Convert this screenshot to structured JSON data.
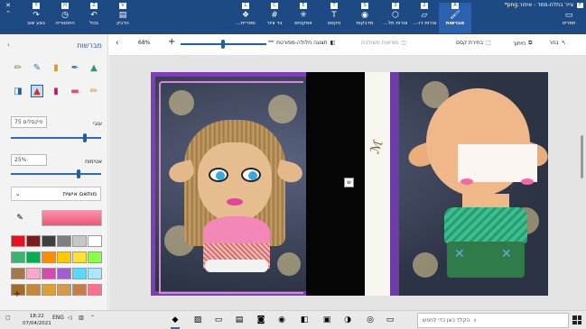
{
  "window": {
    "title": "צייר בתלת-ממד - איפור.png*",
    "shortcut_badge": "F",
    "menu_label": "תפריט"
  },
  "ribbon": {
    "tabs": [
      {
        "key": "A",
        "label": "מברשות",
        "icon": "brush-icon",
        "glyph": "🖌",
        "active": true
      },
      {
        "key": "2",
        "label": "צורות דו-...",
        "icon": "2d-shapes-icon",
        "glyph": "▱",
        "active": false
      },
      {
        "key": "3",
        "label": "צורות תל...",
        "icon": "3d-shapes-icon",
        "glyph": "⬡",
        "active": false
      },
      {
        "key": "S",
        "label": "מדבקות",
        "icon": "stickers-icon",
        "glyph": "◉",
        "active": false
      },
      {
        "key": "T",
        "label": "טקסט",
        "icon": "text-icon",
        "glyph": "T",
        "active": false
      },
      {
        "key": "E",
        "label": "אפקטים",
        "icon": "effects-icon",
        "glyph": "✳",
        "active": false
      },
      {
        "key": "C",
        "label": "בד ציור",
        "icon": "canvas-icon",
        "glyph": "#",
        "active": false
      },
      {
        "key": "L",
        "label": "ספריית...",
        "icon": "library-icon",
        "glyph": "❖",
        "active": false
      }
    ],
    "actions": [
      {
        "key": "V",
        "label": "הדבק",
        "icon": "paste-icon",
        "glyph": "▤"
      },
      {
        "key": "Z",
        "label": "בטל",
        "icon": "undo-icon",
        "glyph": "↶"
      },
      {
        "key": "H",
        "label": "היסטוריה",
        "icon": "history-icon",
        "glyph": "◷"
      },
      {
        "key": "Y",
        "label": "בצע שוב",
        "icon": "redo-icon",
        "glyph": "↷"
      }
    ]
  },
  "toolbar": {
    "select": "בחר",
    "crop": "חיתוך",
    "magic_select": "בחירת קסם",
    "mixed_reality": "מציאות משולבת",
    "view_3d": "תצוגה חלולה-מפורטת",
    "zoom": "68%"
  },
  "panel": {
    "title": "מברשות",
    "brushes": [
      {
        "icon": "marker-brush-icon",
        "glyph": "▲",
        "color": "#2a9a6f"
      },
      {
        "icon": "calligraphy-pen-icon",
        "glyph": "✒",
        "color": "#1f6fb0"
      },
      {
        "icon": "oil-brush-icon",
        "glyph": "▮",
        "color": "#d99a2b"
      },
      {
        "icon": "watercolor-brush-icon",
        "glyph": "✎",
        "color": "#2a7fb0"
      },
      {
        "icon": "pixel-pen-icon",
        "glyph": "✏",
        "color": "#5b9b2b"
      },
      {
        "icon": "pencil-icon",
        "glyph": "✏",
        "color": "#d8832b"
      },
      {
        "icon": "eraser-icon",
        "glyph": "▬",
        "color": "#e04f7a"
      },
      {
        "icon": "crayon-icon",
        "glyph": "▮",
        "color": "#c2185b"
      },
      {
        "icon": "spray-can-icon",
        "glyph": "▲",
        "color": "#c0392b"
      },
      {
        "icon": "fill-icon",
        "glyph": "◨",
        "color": "#1f5fa9"
      }
    ],
    "thickness_label": "עובי",
    "thickness_value": "75 פיקסלים",
    "thickness_level": 0.82,
    "opacity_label": "אטימות",
    "opacity_value": "25%",
    "opacity_level": 0.75,
    "finish_label": "מותאם אישית",
    "colors": [
      "#ffffff",
      "#c7c7c7",
      "#7f7f7f",
      "#3f3f3f",
      "#7a1c1c",
      "#e81123",
      "#8cff45",
      "#ffe033",
      "#ffc900",
      "#ff8c00",
      "#00b050",
      "#3cb371",
      "#a9e8ff",
      "#5cd8ff",
      "#a05fd0",
      "#d54ba9",
      "#ffa8c9",
      "#a07a4b",
      "#ff6f8e",
      "#c97b4a",
      "#d49a4a",
      "#e0a030",
      "#c48838",
      "#a46a2c"
    ]
  },
  "taskbar": {
    "search_placeholder": "הקלד כאן כדי לחפש",
    "time": "18:22",
    "date": "07/04/2021",
    "language": "ENG"
  }
}
